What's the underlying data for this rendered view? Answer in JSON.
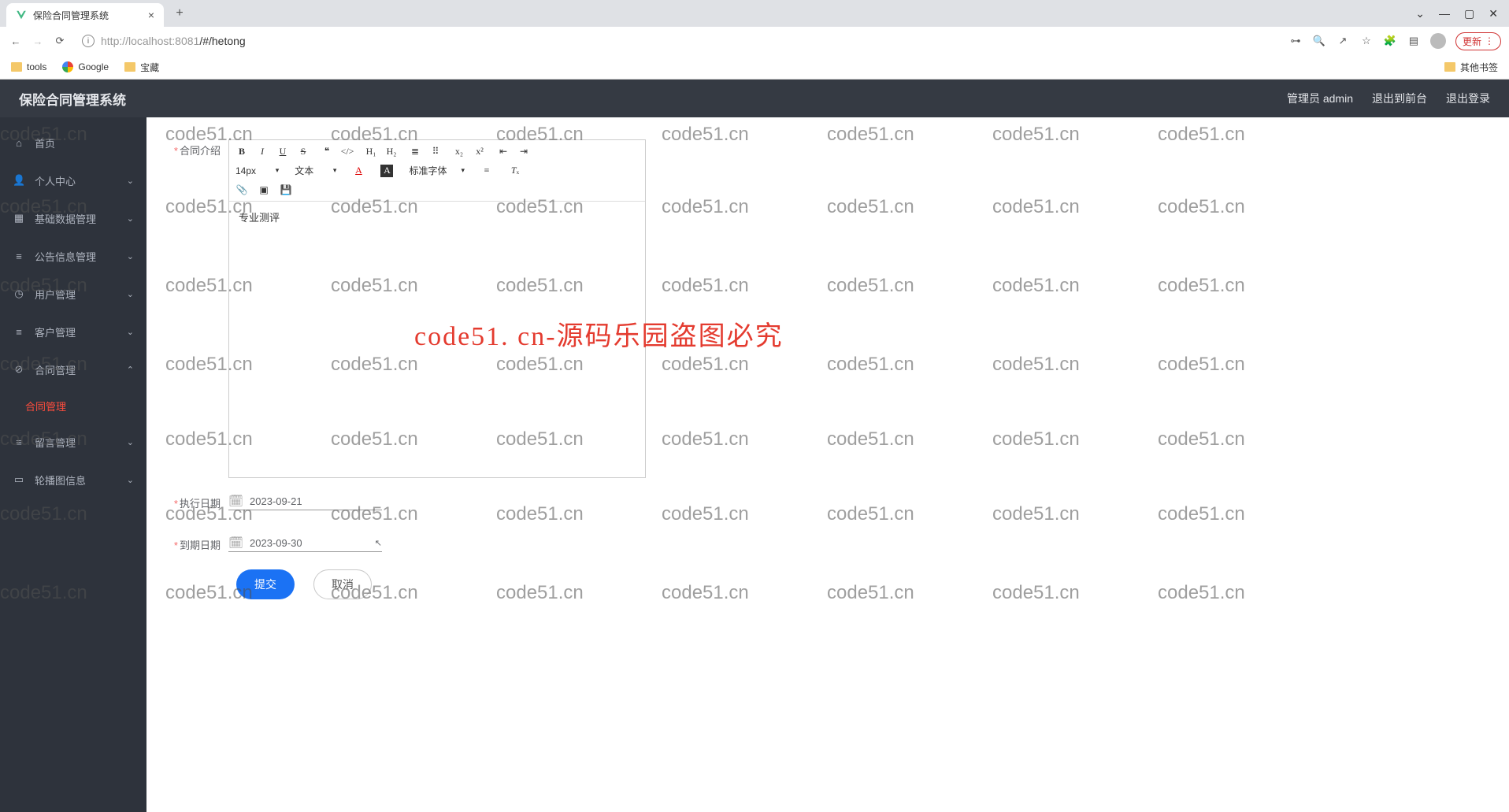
{
  "browser": {
    "tab_title": "保险合同管理系统",
    "url_host": "localhost:8081",
    "url_path": "/#/hetong",
    "update_label": "更新",
    "bookmarks": {
      "tools": "tools",
      "google": "Google",
      "baozang": "宝藏",
      "other": "其他书签"
    }
  },
  "header": {
    "title": "保险合同管理系统",
    "user": "管理员 admin",
    "logout_front": "退出到前台",
    "logout": "退出登录"
  },
  "sidebar": {
    "home": "首页",
    "personal": "个人中心",
    "basedata": "基础数据管理",
    "notice": "公告信息管理",
    "users": "用户管理",
    "customers": "客户管理",
    "contracts": "合同管理",
    "contracts_sub": "合同管理",
    "messages": "留言管理",
    "carousel": "轮播图信息"
  },
  "form": {
    "intro_label": "合同介绍",
    "intro_value": "专业测评",
    "exec_label": "执行日期",
    "exec_value": "2023-09-21",
    "due_label": "到期日期",
    "due_value": "2023-09-30",
    "submit": "提交",
    "cancel": "取消"
  },
  "editor_toolbar": {
    "font_size": "14px",
    "text_type": "文本",
    "font_family": "标准字体"
  },
  "watermark": {
    "small": "code51.cn",
    "big": "code51. cn-源码乐园盗图必究"
  }
}
